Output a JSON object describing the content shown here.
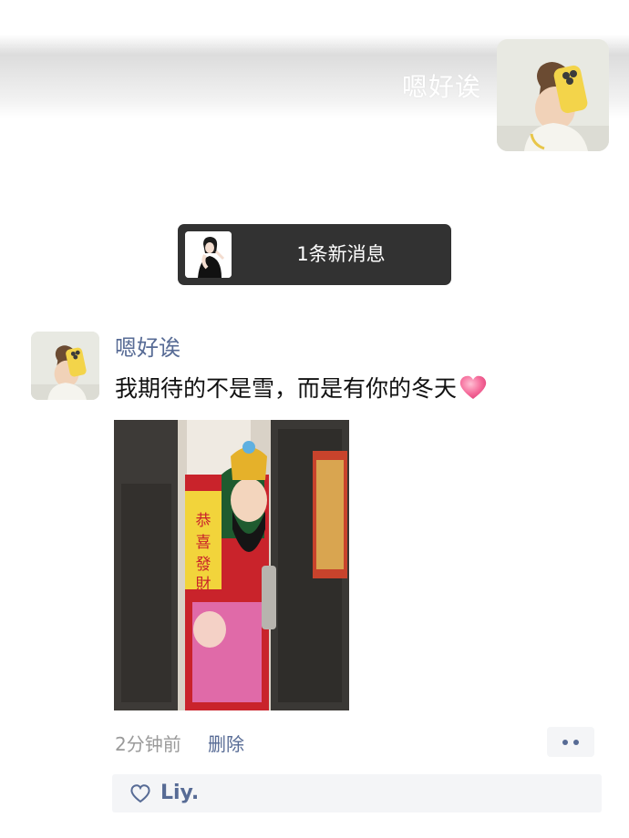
{
  "cover": {
    "name": "嗯好诶"
  },
  "notice": {
    "text": "1条新消息"
  },
  "post": {
    "author": "嗯好诶",
    "text": "我期待的不是雪，而是有你的冬天",
    "emoji": "pink-heart-emoji",
    "photo_text": "恭喜發財",
    "time": "2分钟前",
    "delete_label": "删除",
    "more_icon": "two-dots-icon"
  },
  "likes": {
    "icon": "heart-outline-icon",
    "names": "Liy."
  },
  "colors": {
    "link": "#576b95",
    "notice_bg": "#323232",
    "likes_bg": "#f4f5f7",
    "time": "#9a9a9a"
  }
}
